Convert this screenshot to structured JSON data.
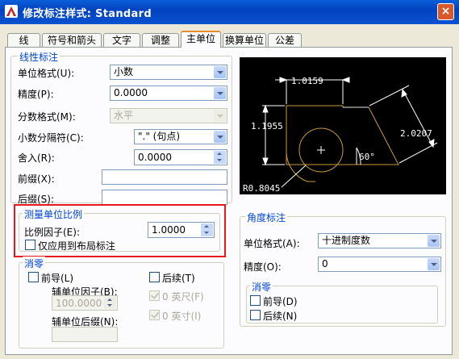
{
  "window": {
    "title": "修改标注样式: Standard",
    "close_label": "×"
  },
  "tabs": [
    {
      "label": "线"
    },
    {
      "label": "符号和箭头"
    },
    {
      "label": "文字"
    },
    {
      "label": "调整"
    },
    {
      "label": "主单位",
      "active": true
    },
    {
      "label": "换算单位"
    },
    {
      "label": "公差"
    }
  ],
  "linear": {
    "title": "线性标注",
    "unit_format_label": "单位格式(U):",
    "unit_format_value": "小数",
    "precision_label": "精度(P):",
    "precision_value": "0.0000",
    "fraction_format_label": "分数格式(M):",
    "fraction_format_value": "水平",
    "decimal_sep_label": "小数分隔符(C):",
    "decimal_sep_value": "\".\" (句点)",
    "roundoff_label": "舍入(R):",
    "roundoff_value": "0.0000",
    "prefix_label": "前缀(X):",
    "prefix_value": "",
    "suffix_label": "后缀(S):",
    "suffix_value": ""
  },
  "scale": {
    "title": "测量单位比例",
    "factor_label": "比例因子(E):",
    "factor_value": "1.0000",
    "layout_only_label": "仅应用到布局标注"
  },
  "zero_linear": {
    "title": "消零",
    "leading_label": "前导(L)",
    "sub_factor_label": "辅单位因子(B):",
    "sub_factor_value": "100.0000",
    "sub_suffix_label": "辅单位后缀(N):",
    "sub_suffix_value": "",
    "trailing_label": "后续(T)",
    "feet_label": "0 英尺(F)",
    "inches_label": "0 英寸(I)"
  },
  "preview": {
    "dim_top": "1.0159",
    "dim_left": "1.1955",
    "dim_right": "2.0207",
    "dim_angle": "60°",
    "dim_radius": "R0.8045"
  },
  "angular": {
    "title": "角度标注",
    "unit_format_label": "单位格式(A):",
    "unit_format_value": "十进制度数",
    "precision_label": "精度(O):",
    "precision_value": "0",
    "zero_title": "消零",
    "leading_label": "前导(D)",
    "trailing_label": "后续(N)"
  },
  "colors": {
    "accent_tab": "#e68b2c",
    "group_title": "#0046d5",
    "highlight": "#e8161d"
  }
}
